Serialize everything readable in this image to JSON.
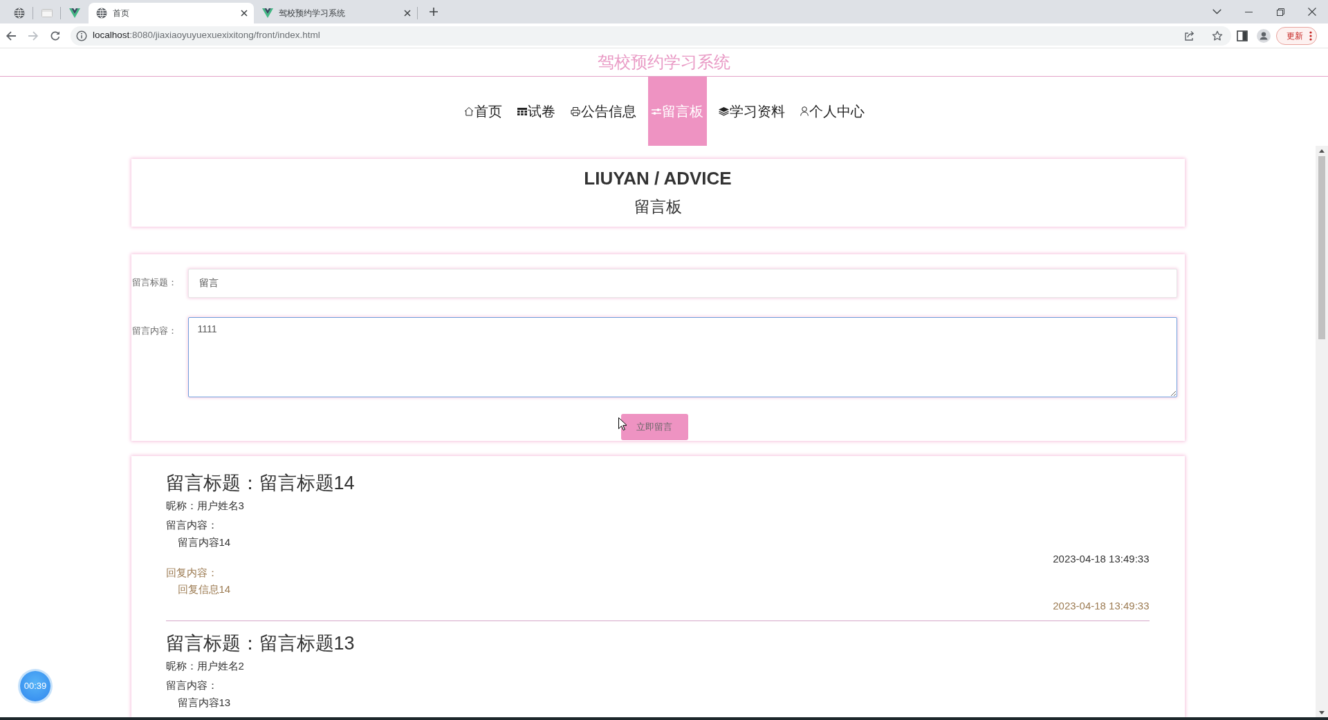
{
  "browser": {
    "tabs": [
      {
        "selected": false
      },
      {
        "selected": false
      },
      {
        "selected": false
      },
      {
        "title": "首页",
        "selected": true
      },
      {
        "title": "驾校预约学习系统",
        "selected": false
      }
    ],
    "nav_buttons": [
      {
        "disabled": false
      },
      {
        "disabled": true
      },
      {
        "disabled": false
      }
    ],
    "address": {
      "host": "localhost",
      "path": ":8080/jiaxiaoyuyuexuexixitong/front/index.html"
    },
    "update_button": "更新"
  },
  "site_title": "驾校预约学习系统",
  "nav": [
    {
      "label": "首页",
      "selected": false
    },
    {
      "label": "试卷",
      "selected": false
    },
    {
      "label": "公告信息",
      "selected": false
    },
    {
      "label": "留言板",
      "selected": true
    },
    {
      "label": "学习资料",
      "selected": false
    },
    {
      "label": "个人中心",
      "selected": false
    }
  ],
  "banner": {
    "title": "LIUYAN / ADVICE",
    "subtitle": "留言板"
  },
  "form": {
    "fields": [
      {
        "kind": "input",
        "label": "留言标题：",
        "value": "留言",
        "focused": false
      },
      {
        "kind": "textarea",
        "label": "留言内容：",
        "value": "1111",
        "focused": true
      }
    ],
    "submit": "立即留言"
  },
  "messages": [
    {
      "title": "留言标题：留言标题14",
      "nickname": "昵称：用户姓名3",
      "content_label": "留言内容：",
      "content": "留言内容14",
      "time": "2023-04-18 13:49:33",
      "reply_label": "回复内容：",
      "reply": "回复信息14",
      "reply_time": "2023-04-18 13:49:33"
    },
    {
      "title": "留言标题：留言标题13",
      "nickname": "昵称：用户姓名2",
      "content_label": "留言内容：",
      "content": "留言内容13"
    }
  ],
  "timer": "00:39"
}
